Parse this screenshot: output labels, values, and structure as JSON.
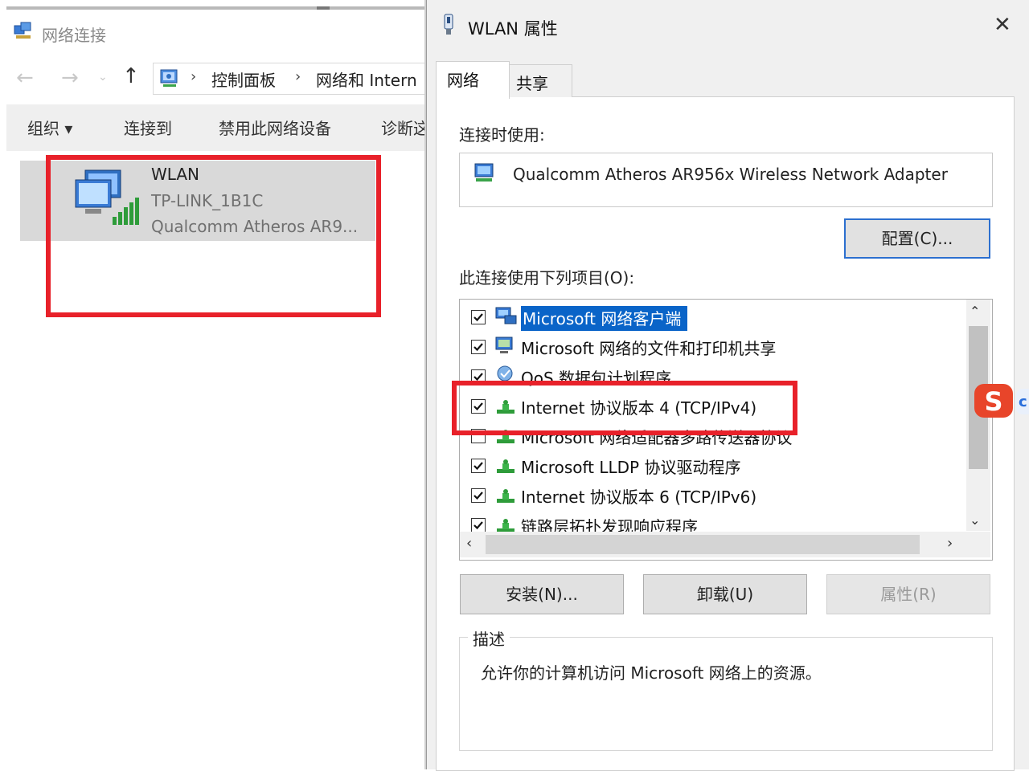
{
  "explorer": {
    "title": "网络连接",
    "breadcrumb": [
      "控制面板",
      "网络和 Intern"
    ],
    "commands": {
      "organize": "组织 ▾",
      "connect_to": "连接到",
      "disable_device": "禁用此网络设备",
      "diagnose": "诊断这"
    },
    "connection": {
      "name": "WLAN",
      "ssid": "TP-LINK_1B1C",
      "adapter": "Qualcomm Atheros AR9..."
    }
  },
  "dialog": {
    "title": "WLAN 属性",
    "tabs": [
      "网络",
      "共享"
    ],
    "active_tab": "网络",
    "connect_using_label": "连接时使用:",
    "adapter_name": "Qualcomm Atheros AR956x Wireless Network Adapter",
    "configure_button": "配置(C)...",
    "components_label": "此连接使用下列项目(O):",
    "components": [
      {
        "label": "Microsoft 网络客户端",
        "checked": true,
        "selected": true,
        "icon": "network-client-icon"
      },
      {
        "label": "Microsoft 网络的文件和打印机共享",
        "checked": true,
        "selected": false,
        "icon": "file-share-icon"
      },
      {
        "label": "QoS 数据包计划程序",
        "checked": true,
        "selected": false,
        "icon": "qos-icon"
      },
      {
        "label": "Internet 协议版本 4 (TCP/IPv4)",
        "checked": true,
        "selected": false,
        "icon": "protocol-icon"
      },
      {
        "label": "Microsoft 网络适配器多路传送器协议",
        "checked": false,
        "selected": false,
        "icon": "protocol-icon"
      },
      {
        "label": "Microsoft LLDP 协议驱动程序",
        "checked": true,
        "selected": false,
        "icon": "protocol-icon"
      },
      {
        "label": "Internet 协议版本 6 (TCP/IPv6)",
        "checked": true,
        "selected": false,
        "icon": "protocol-icon"
      },
      {
        "label": "链路层拓扑发现响应程序",
        "checked": true,
        "selected": false,
        "icon": "protocol-icon"
      }
    ],
    "buttons": {
      "install": "安装(N)...",
      "uninstall": "卸载(U)",
      "properties": "属性(R)"
    },
    "description_label": "描述",
    "description_text": "允许你的计算机访问 Microsoft 网络上的资源。"
  },
  "colors": {
    "highlight_red": "#e8212a",
    "selection_blue": "#0a64c8",
    "focus_border": "#2c6fcf"
  }
}
